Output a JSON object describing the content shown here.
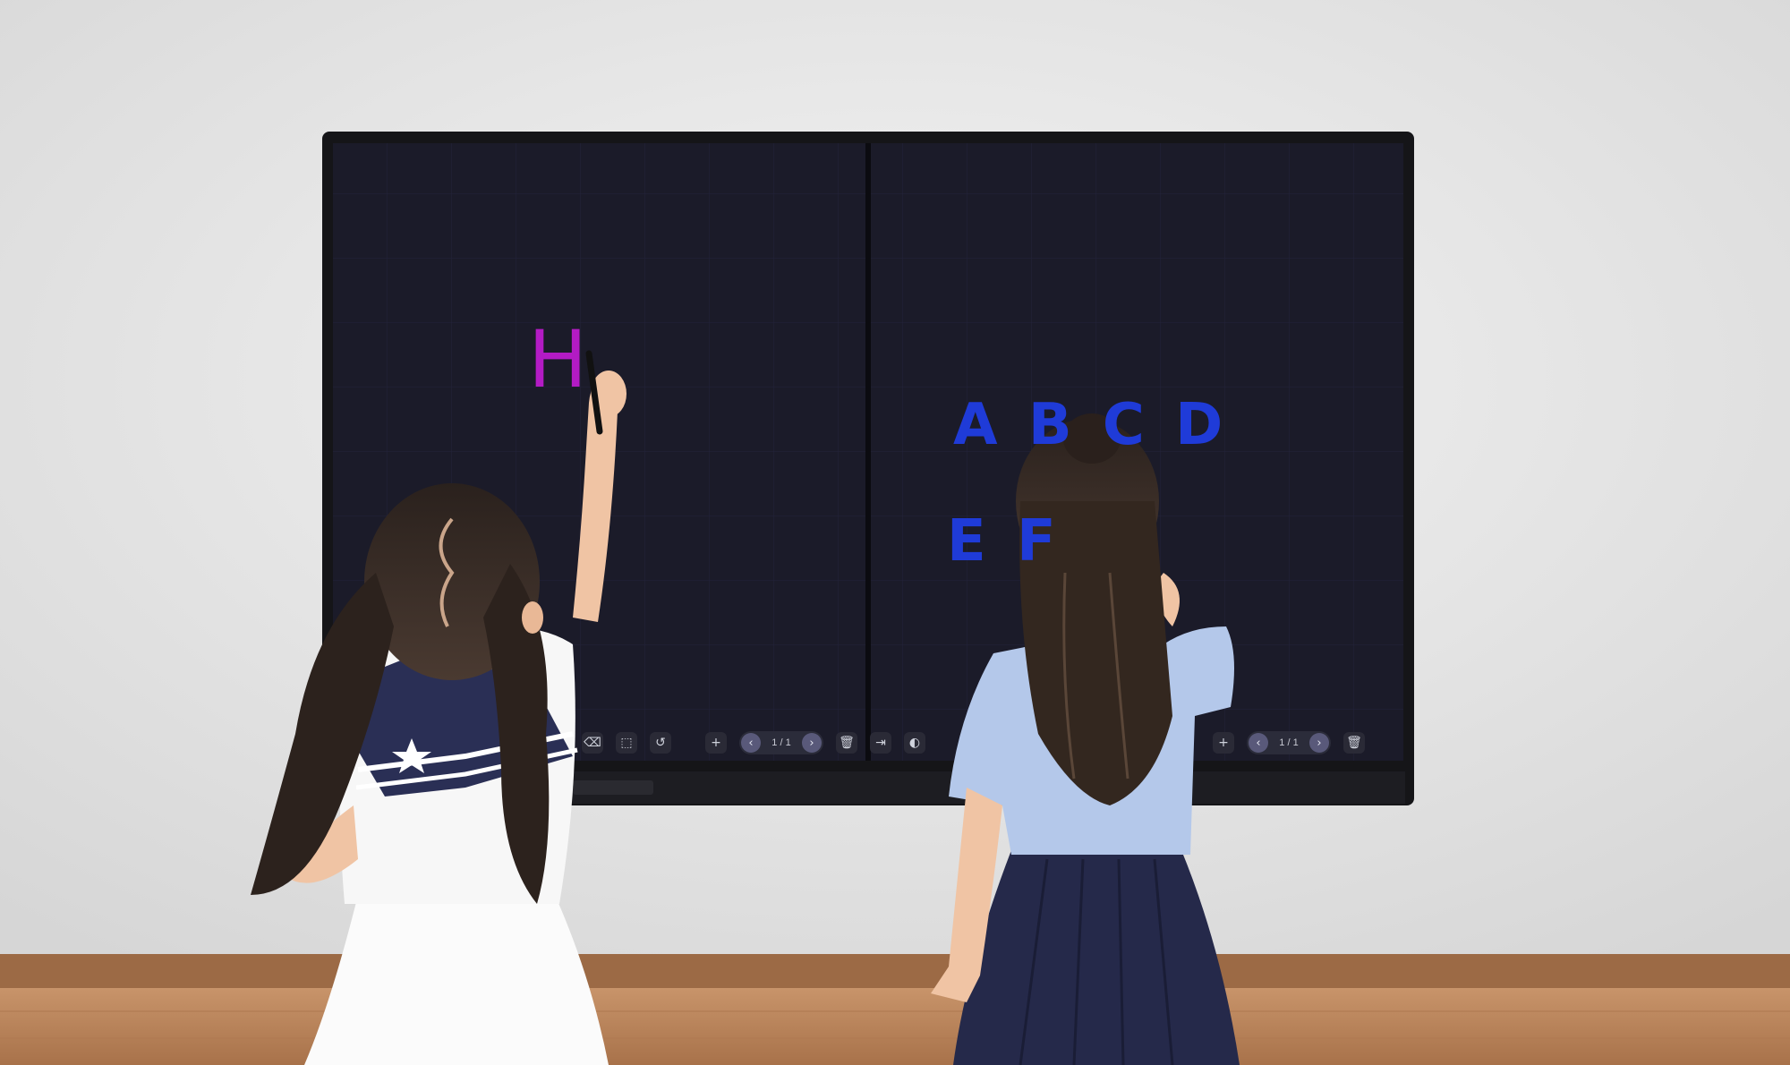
{
  "colors": {
    "wall": "#e9e9e9",
    "floor": "#b9835a",
    "panel_bezel": "#111114",
    "screen": "#1b1b29",
    "pink_ink": "#b31bc4",
    "blue_ink": "#1f3bd8"
  },
  "left_board": {
    "handwriting": "H",
    "toolbar": {
      "icons": [
        "eraser-icon",
        "select-icon",
        "undo-icon",
        "add-icon",
        "delete-icon",
        "export-icon",
        "palette-icon"
      ],
      "page_indicator": "1 / 1"
    }
  },
  "right_board": {
    "handwriting_line1": "A B C D",
    "handwriting_line2": "E F",
    "toolbar": {
      "icons": [
        "add-icon",
        "delete-icon"
      ],
      "page_indicator": "1 / 1"
    }
  }
}
